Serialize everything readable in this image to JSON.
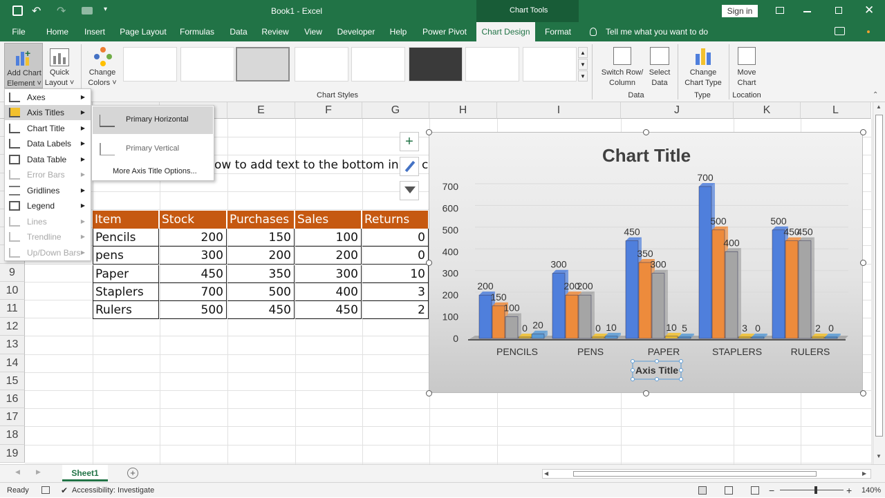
{
  "titlebar": {
    "book": "Book1 - Excel",
    "context": "Chart Tools",
    "sign_in": "Sign in"
  },
  "tabs": [
    "File",
    "Home",
    "Insert",
    "Page Layout",
    "Formulas",
    "Data",
    "Review",
    "View",
    "Developer",
    "Help",
    "Power Pivot",
    "Chart Design",
    "Format"
  ],
  "tell_me": "Tell me what you want to do",
  "ribbon": {
    "add_chart_1": "Add Chart",
    "add_chart_2": "Element ˅",
    "quick_1": "Quick",
    "quick_2": "Layout ˅",
    "colors_1": "Change",
    "colors_2": "Colors ˅",
    "chart_styles": "Chart Styles",
    "switch_1": "Switch Row/",
    "switch_2": "Column",
    "select_1": "Select",
    "select_2": "Data",
    "group_data": "Data",
    "ctype_1": "Change",
    "ctype_2": "Chart Type",
    "group_type": "Type",
    "move_1": "Move",
    "move_2": "Chart",
    "group_location": "Location"
  },
  "menu": {
    "items": [
      "Axes",
      "Axis Titles",
      "Chart Title",
      "Data Labels",
      "Data Table",
      "Error Bars",
      "Gridlines",
      "Legend",
      "Lines",
      "Trendline",
      "Up/Down Bars"
    ]
  },
  "submenu": {
    "primary_h": "Primary Horizontal",
    "primary_v": "Primary Vertical",
    "more": "More Axis Title Options..."
  },
  "columns": [
    "E",
    "F",
    "G",
    "H",
    "I",
    "J",
    "K",
    "L"
  ],
  "rows": [
    "9",
    "10",
    "11",
    "12",
    "13",
    "14",
    "15",
    "16",
    "17",
    "18",
    "19"
  ],
  "sheet_text": "ow to add text to the bottom in Ex",
  "sheet_text_tail": "c",
  "table": {
    "headers": [
      "Item",
      "Stock",
      "Purchases",
      "Sales",
      "Returns"
    ],
    "rows": [
      [
        "Pencils",
        "200",
        "150",
        "100",
        "0"
      ],
      [
        "pens",
        "300",
        "200",
        "200",
        "0"
      ],
      [
        "Paper",
        "450",
        "350",
        "300",
        "10"
      ],
      [
        "Staplers",
        "700",
        "500",
        "400",
        "3"
      ],
      [
        "Rulers",
        "500",
        "450",
        "450",
        "2"
      ]
    ]
  },
  "chart_data": {
    "type": "bar",
    "title": "Chart Title",
    "xlabel": "Axis Title",
    "ylabel": "",
    "categories": [
      "PENCILS",
      "PENS",
      "PAPER",
      "STAPLERS",
      "RULERS"
    ],
    "yticks": [
      "0",
      "100",
      "200",
      "300",
      "400",
      "500",
      "600",
      "700"
    ],
    "ylim": [
      0,
      700
    ],
    "series": [
      {
        "values": [
          200,
          300,
          450,
          700,
          500
        ],
        "color": "#4f7fdc"
      },
      {
        "values": [
          150,
          200,
          350,
          500,
          450
        ],
        "color": "#ed8b3c"
      },
      {
        "values": [
          100,
          200,
          300,
          400,
          450
        ],
        "color": "#a5a5a5"
      },
      {
        "values": [
          0,
          0,
          10,
          3,
          2
        ],
        "color": "#f2c12e"
      },
      {
        "values": [
          20,
          10,
          5,
          0,
          0
        ],
        "color": "#5b9bd5"
      }
    ],
    "data_labels": true
  },
  "sheet_tab": "Sheet1",
  "status": {
    "ready": "Ready",
    "accessibility": "Accessibility: Investigate",
    "zoom": "140%"
  }
}
